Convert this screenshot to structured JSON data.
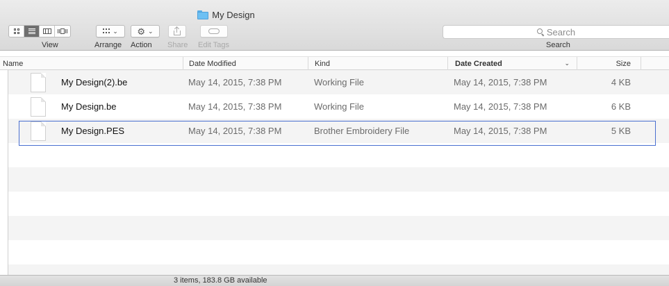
{
  "window": {
    "title": "My Design"
  },
  "toolbar": {
    "view_label": "View",
    "arrange_label": "Arrange",
    "action_label": "Action",
    "share_label": "Share",
    "edit_tags_label": "Edit Tags",
    "search_placeholder": "Search",
    "search_label": "Search"
  },
  "columns": {
    "name": "Name",
    "date_modified": "Date Modified",
    "kind": "Kind",
    "date_created": "Date Created",
    "size": "Size"
  },
  "files": [
    {
      "name": "My Design(2).be",
      "date_modified": "May 14, 2015, 7:38 PM",
      "kind": "Working File",
      "date_created": "May 14, 2015, 7:38 PM",
      "size": "4 KB"
    },
    {
      "name": "My Design.be",
      "date_modified": "May 14, 2015, 7:38 PM",
      "kind": "Working File",
      "date_created": "May 14, 2015, 7:38 PM",
      "size": "6 KB"
    },
    {
      "name": "My Design.PES",
      "date_modified": "May 14, 2015, 7:38 PM",
      "kind": "Brother Embroidery File",
      "date_created": "May 14, 2015, 7:38 PM",
      "size": "5 KB"
    }
  ],
  "status": {
    "text": "3 items, 183.8 GB available"
  },
  "colors": {
    "selection_border": "#4a6fd0",
    "folder": "#6dc0f3"
  }
}
